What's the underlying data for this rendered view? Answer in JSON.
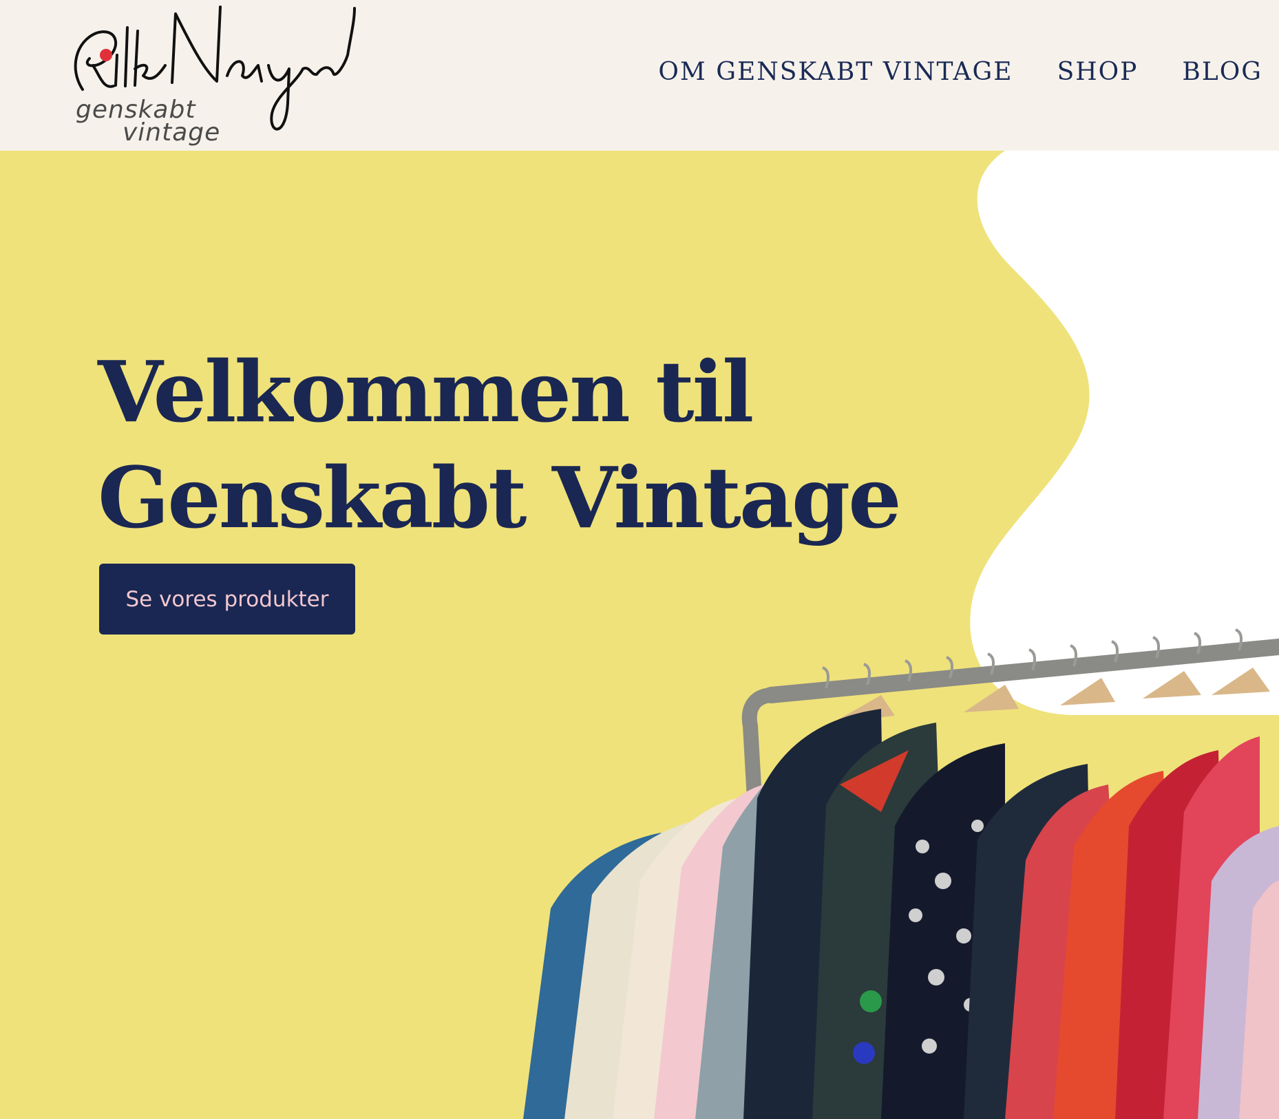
{
  "brand": {
    "signature": "Rikke Nørgaard",
    "line1": "genskabt",
    "line2": "vintage"
  },
  "nav": {
    "items": [
      {
        "label": "OM GENSKABT VINTAGE"
      },
      {
        "label": "SHOP"
      },
      {
        "label": "BLOG"
      }
    ]
  },
  "hero": {
    "title_line1": "Velkommen til",
    "title_line2": "Genskabt Vintage",
    "cta_label": "Se vores produkter",
    "image": "clothing-rack-photo"
  },
  "colors": {
    "header_bg": "#f6f2eb",
    "hero_bg": "#efe27a",
    "navy": "#1a2753",
    "cta_text": "#f2c7cf",
    "logo_dot": "#e0313b"
  }
}
